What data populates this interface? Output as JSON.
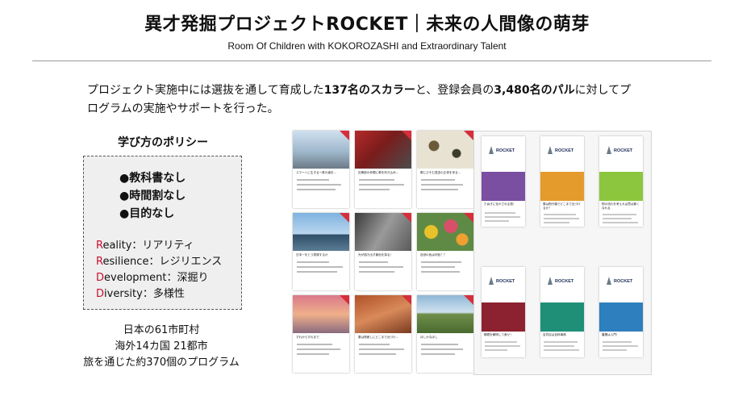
{
  "header": {
    "title": "異才発掘プロジェクトROCKET｜未来の人間像の萌芽",
    "subtitle": "Room Of Children with KOKOROZASHI and Extraordinary Talent"
  },
  "intro": {
    "p1": "プロジェクト実施中には選抜を通して育成した",
    "b1": "137名のスカラー",
    "p2": "と、登録会員の",
    "b2": "3,480名のパル",
    "p3": "に対してプ",
    "line2": "ログラムの実施やサポートを行った。"
  },
  "policy": {
    "title": "学び方のポリシー",
    "items": [
      "●教科書なし",
      "●時間割なし",
      "●目的なし"
    ],
    "values": [
      {
        "initial": "R",
        "rest": "eality：リアリティ"
      },
      {
        "initial": "R",
        "rest": "esilience：レジリエンス"
      },
      {
        "initial": "D",
        "rest": "evelopment：深掘り"
      },
      {
        "initial": "D",
        "rest": "iversity：多様性"
      }
    ]
  },
  "stats": {
    "line1": "日本の61市町村",
    "line2": "海外14カ国 21都市",
    "line3": "旅を通じた約370個のプログラム"
  },
  "cards": [
    {
      "caption": "スマートに生きる〜鉄の道を…"
    },
    {
      "caption": "旧車部の仲間に車を吹き込め…"
    },
    {
      "caption": "眼にひそむ昆虫の正体を来る…"
    },
    {
      "caption": "日本一をとう表現するか"
    },
    {
      "caption": "光が描き出す景色を探る！"
    },
    {
      "caption": "自然の色は何色？？"
    },
    {
      "caption": "すれからすれまで"
    },
    {
      "caption": "雲は物差しにどこまで近づけ…"
    },
    {
      "caption": "ほしかなほし"
    }
  ],
  "posters": [
    {
      "brand": "ROCKET",
      "caption": "たぬきに化かされる旅！"
    },
    {
      "brand": "ROCKET",
      "caption": "雲は飛行機でどこまで近づけるか？"
    },
    {
      "brand": "ROCKET",
      "caption": "物の流れを考えれば意は繋くなれる"
    },
    {
      "brand": "ROCKET",
      "caption": "鋼鐵を解明して食せ！"
    },
    {
      "brand": "ROCKET",
      "caption": "百貨店は百科事典"
    },
    {
      "brand": "ROCKET",
      "caption": "農業は入門！"
    }
  ],
  "colors": {
    "accent_red": "#c8102e",
    "poster_bands": [
      "#7a4ea0",
      "#e59a2c",
      "#8cc63e",
      "#8c2230",
      "#1f8f78",
      "#2e7fbd"
    ]
  }
}
